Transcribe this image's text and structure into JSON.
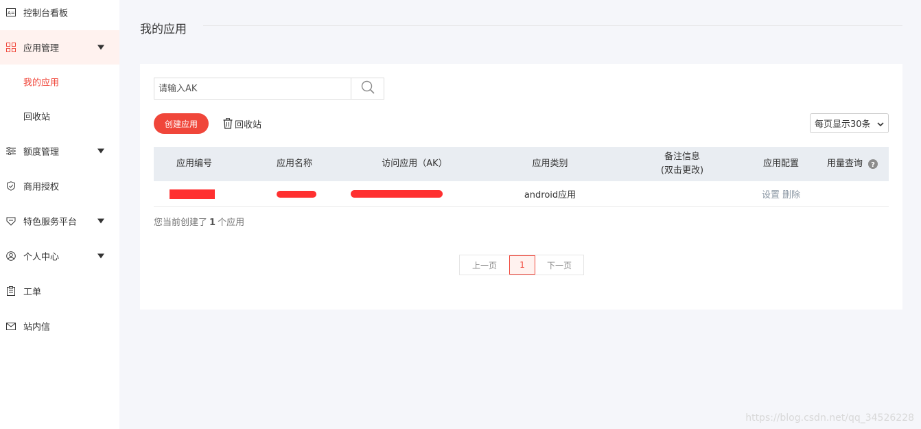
{
  "sidebar": {
    "items": [
      {
        "label": "控制台看板",
        "icon": "dashboard-card-icon"
      },
      {
        "label": "应用管理",
        "icon": "grid-apps-icon",
        "expanded": true
      },
      {
        "label": "我的应用",
        "sub": true,
        "selected": true
      },
      {
        "label": "回收站",
        "sub": true
      },
      {
        "label": "额度管理",
        "icon": "sliders-icon"
      },
      {
        "label": "商用授权",
        "icon": "shield-check-icon"
      },
      {
        "label": "特色服务平台",
        "icon": "service-badge-icon"
      },
      {
        "label": "个人中心",
        "icon": "user-circle-icon"
      },
      {
        "label": "工单",
        "icon": "clipboard-icon"
      },
      {
        "label": "站内信",
        "icon": "mail-icon"
      }
    ]
  },
  "page": {
    "title": "我的应用"
  },
  "search": {
    "placeholder": "请输入AK",
    "value": ""
  },
  "toolbar": {
    "create_label": "创建应用",
    "recycle_label": "回收站",
    "page_size_label": "每页显示30条"
  },
  "table": {
    "headers": {
      "id": "应用编号",
      "name": "应用名称",
      "ak": "访问应用（AK）",
      "type": "应用类别",
      "remark_line1": "备注信息",
      "remark_line2": "(双击更改)",
      "config": "应用配置",
      "usage": "用量查询"
    },
    "rows": [
      {
        "type": "android应用",
        "remark": "",
        "action_settings": "设置",
        "action_delete": "删除"
      }
    ]
  },
  "summary": {
    "prefix": "您当前创建了",
    "count": "1",
    "suffix": "个应用"
  },
  "pagination": {
    "prev": "上一页",
    "current": "1",
    "next": "下一页"
  },
  "watermark": "https://blog.csdn.net/qq_34526228",
  "colors": {
    "accent": "#f0463a",
    "active_bg": "#fff2ef",
    "header_bg": "#e9edf2",
    "redaction": "#ff3030"
  }
}
